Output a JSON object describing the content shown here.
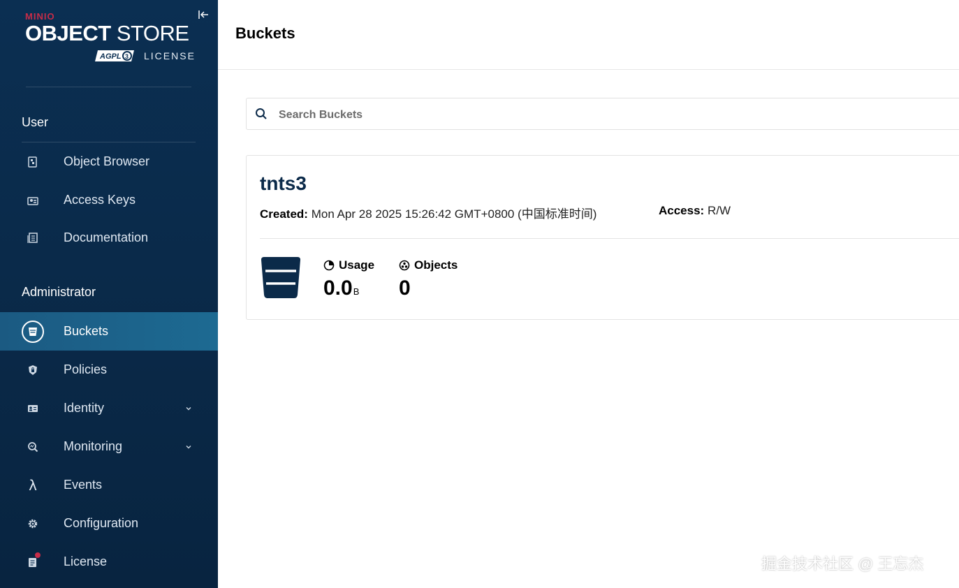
{
  "sidebar": {
    "logo": {
      "brand": "MINIO",
      "product_bold": "OBJECT",
      "product_light": " STORE",
      "badge": "AGPLv3",
      "license": "LICENSE"
    },
    "sections": {
      "user": "User",
      "admin": "Administrator"
    },
    "user_items": [
      {
        "label": "Object Browser",
        "icon": "object-browser-icon"
      },
      {
        "label": "Access Keys",
        "icon": "access-keys-icon"
      },
      {
        "label": "Documentation",
        "icon": "documentation-icon"
      }
    ],
    "admin_items": [
      {
        "label": "Buckets",
        "icon": "bucket-icon",
        "active": true
      },
      {
        "label": "Policies",
        "icon": "shield-icon"
      },
      {
        "label": "Identity",
        "icon": "identity-icon",
        "expandable": true
      },
      {
        "label": "Monitoring",
        "icon": "monitoring-icon",
        "expandable": true
      },
      {
        "label": "Events",
        "icon": "lambda-icon"
      },
      {
        "label": "Configuration",
        "icon": "gear-icon"
      },
      {
        "label": "License",
        "icon": "license-icon",
        "notification": true
      }
    ]
  },
  "header": {
    "title": "Buckets"
  },
  "search": {
    "placeholder": "Search Buckets",
    "value": ""
  },
  "bucket": {
    "name": "tnts3",
    "created_label": "Created:",
    "created_value": "Mon Apr 28 2025 15:26:42 GMT+0800 (中国标准时间)",
    "access_label": "Access:",
    "access_value": "R/W",
    "usage_label": "Usage",
    "usage_value": "0.0",
    "usage_unit": "B",
    "objects_label": "Objects",
    "objects_value": "0"
  },
  "watermark": "掘金技术社区 @ 王忘杰",
  "colors": {
    "sidebar_bg": "#0b2f52",
    "active_item": "#1b5a82",
    "brand_red": "#c72c48",
    "bucket_name": "#0b2a49"
  }
}
